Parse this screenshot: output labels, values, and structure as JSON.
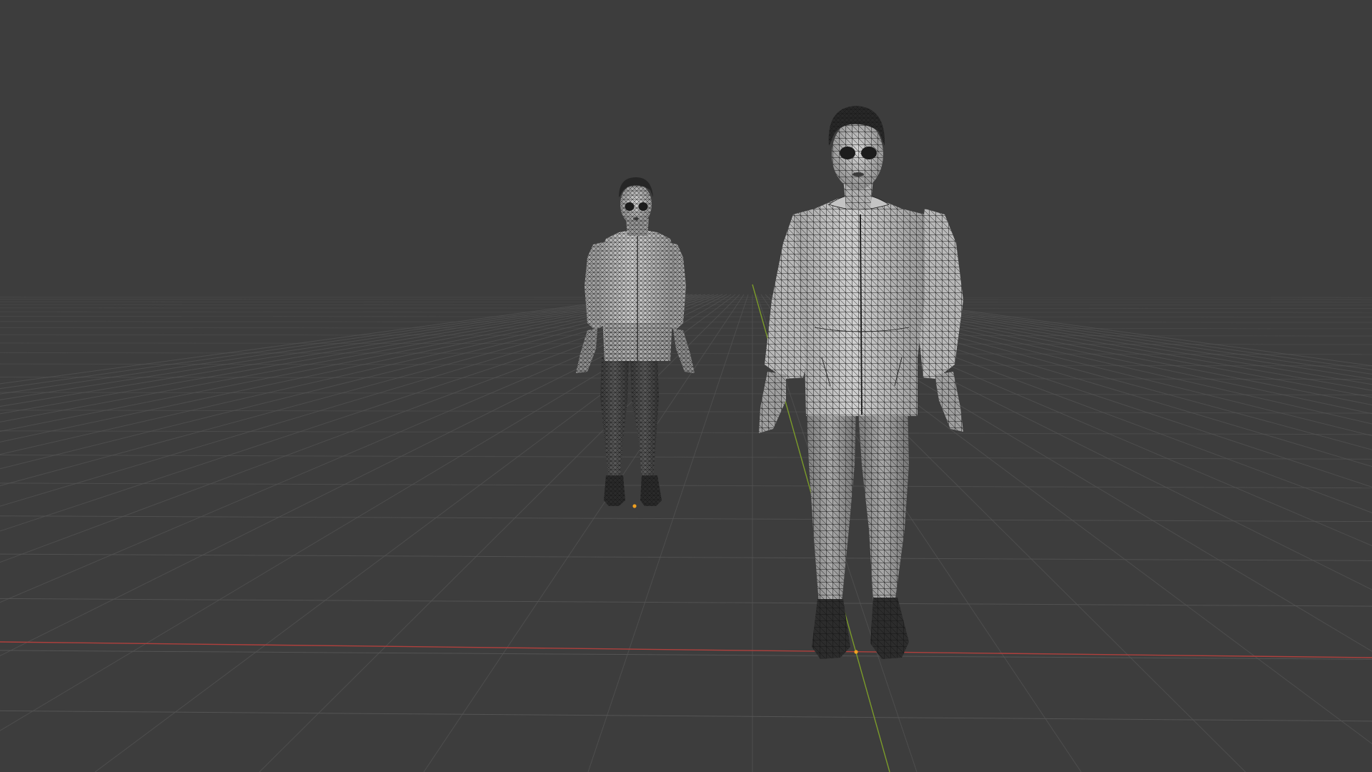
{
  "viewport": {
    "background_color": "#3d3d3d",
    "grid_color": "#555555",
    "x_axis_color": "#b0403d",
    "y_axis_color": "#7b9b2a",
    "origin_marker_color": "#f0a020",
    "mesh_light_color": "#bdbdbd",
    "mesh_dark_color": "#2e2e2e",
    "wire_color": "#111111"
  },
  "scene": {
    "objects": [
      {
        "name": "character-mesh-far",
        "kind": "character",
        "shading": "wireframe-overlay",
        "selected": false
      },
      {
        "name": "character-mesh-near",
        "kind": "character",
        "shading": "wireframe-overlay",
        "selected": false
      }
    ],
    "overlays": {
      "floor_grid": true,
      "x_axis_line": true,
      "y_axis_line": true,
      "wireframe": true
    }
  }
}
